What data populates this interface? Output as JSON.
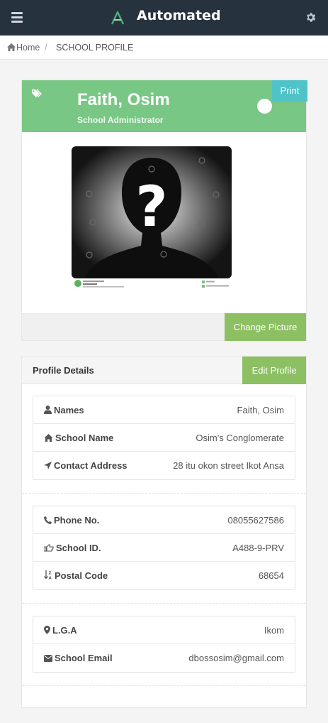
{
  "app": {
    "title": "Automated"
  },
  "breadcrumb": {
    "home": "Home",
    "separator": "/",
    "current": "SCHOOL PROFILE"
  },
  "profile": {
    "name": "Faith, Osim",
    "role": "School Administrator",
    "print_label": "Print",
    "change_picture_label": "Change Picture"
  },
  "details": {
    "title": "Profile Details",
    "edit_label": "Edit Profile",
    "groups": [
      [
        {
          "icon": "user-icon",
          "label": "Names",
          "value": "Faith, Osim"
        },
        {
          "icon": "home-icon",
          "label": "School Name",
          "value": "Osim's Conglomerate"
        },
        {
          "icon": "location-arrow-icon",
          "label": "Contact Address",
          "value": "28 itu okon street Ikot Ansa"
        }
      ],
      [
        {
          "icon": "phone-icon",
          "label": "Phone No.",
          "value": "08055627586"
        },
        {
          "icon": "hand-pointer-icon",
          "label": "School ID.",
          "value": "A488-9-PRV"
        },
        {
          "icon": "sort-alpha-icon",
          "label": "Postal Code",
          "value": "68654"
        }
      ],
      [
        {
          "icon": "map-marker-icon",
          "label": "L.G.A",
          "value": "Ikom"
        },
        {
          "icon": "envelope-icon",
          "label": "School Email",
          "value": "dbossosim@gmail.com"
        }
      ]
    ]
  },
  "colors": {
    "topbar": "#27323f",
    "profile_header": "#79c785",
    "print_button": "#4fc3c8",
    "action_button": "#8cc063"
  }
}
